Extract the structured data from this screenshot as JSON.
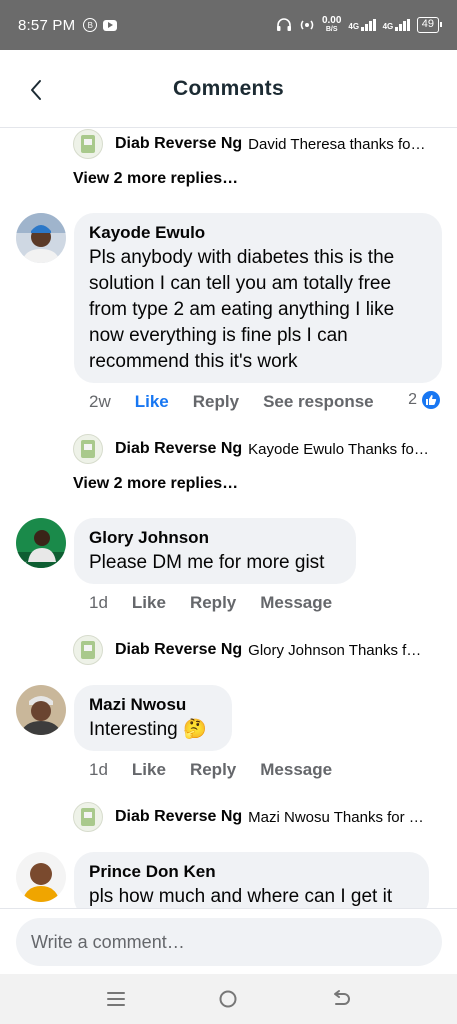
{
  "status_bar": {
    "time": "8:57 PM",
    "data_rate_value": "0.00",
    "data_rate_unit": "B/S",
    "network_1": "4G",
    "network_2": "4G",
    "battery": "49",
    "icons": [
      "b-circle-icon",
      "youtube-icon",
      "headset-icon",
      "hotspot-icon",
      "signal-icon",
      "battery-icon"
    ]
  },
  "header": {
    "title": "Comments",
    "back_icon": "chevron-left-icon"
  },
  "thread": [
    {
      "type": "reply_preview",
      "name": "Diab Reverse Ng",
      "text": "David Theresa thanks fo…"
    },
    {
      "type": "view_more",
      "label": "View 2 more replies…"
    },
    {
      "type": "comment",
      "name": "Kayode Ewulo",
      "lines": [
        "Pls anybody with diabetes this is the",
        "solution I can tell you am totally free",
        "from type 2 am eating anything I like",
        "now everything is fine pls I can",
        "recommend this it's work"
      ],
      "time": "2w",
      "like": "Like",
      "reply": "Reply",
      "extra": "See response",
      "reaction_count": "2",
      "liked": true
    },
    {
      "type": "reply_preview",
      "name": "Diab Reverse Ng",
      "text": "Kayode Ewulo Thanks fo…"
    },
    {
      "type": "view_more",
      "label": "View 2 more replies…"
    },
    {
      "type": "comment",
      "name": "Glory Johnson",
      "lines": [
        "Please DM me for more gist"
      ],
      "time": "1d",
      "like": "Like",
      "reply": "Reply",
      "extra": "Message"
    },
    {
      "type": "reply_preview",
      "name": "Diab Reverse Ng",
      "text": "Glory Johnson Thanks f…"
    },
    {
      "type": "comment",
      "name": "Mazi Nwosu",
      "lines": [
        "Interesting 🤔"
      ],
      "time": "1d",
      "like": "Like",
      "reply": "Reply",
      "extra": "Message"
    },
    {
      "type": "reply_preview",
      "name": "Diab Reverse Ng",
      "text": "Mazi Nwosu Thanks for …"
    },
    {
      "type": "comment",
      "name": "Prince Don Ken",
      "lines": [
        "pls how much and where can I get it"
      ]
    }
  ],
  "composer": {
    "placeholder": "Write a comment…"
  },
  "navbar": {
    "icons": [
      "menu-icon",
      "home-circle-icon",
      "back-arrow-icon"
    ]
  },
  "colors": {
    "accent": "#1877f2",
    "bubble": "#f0f2f5",
    "muted": "#65676b",
    "status_bar": "#6b6b6b"
  }
}
